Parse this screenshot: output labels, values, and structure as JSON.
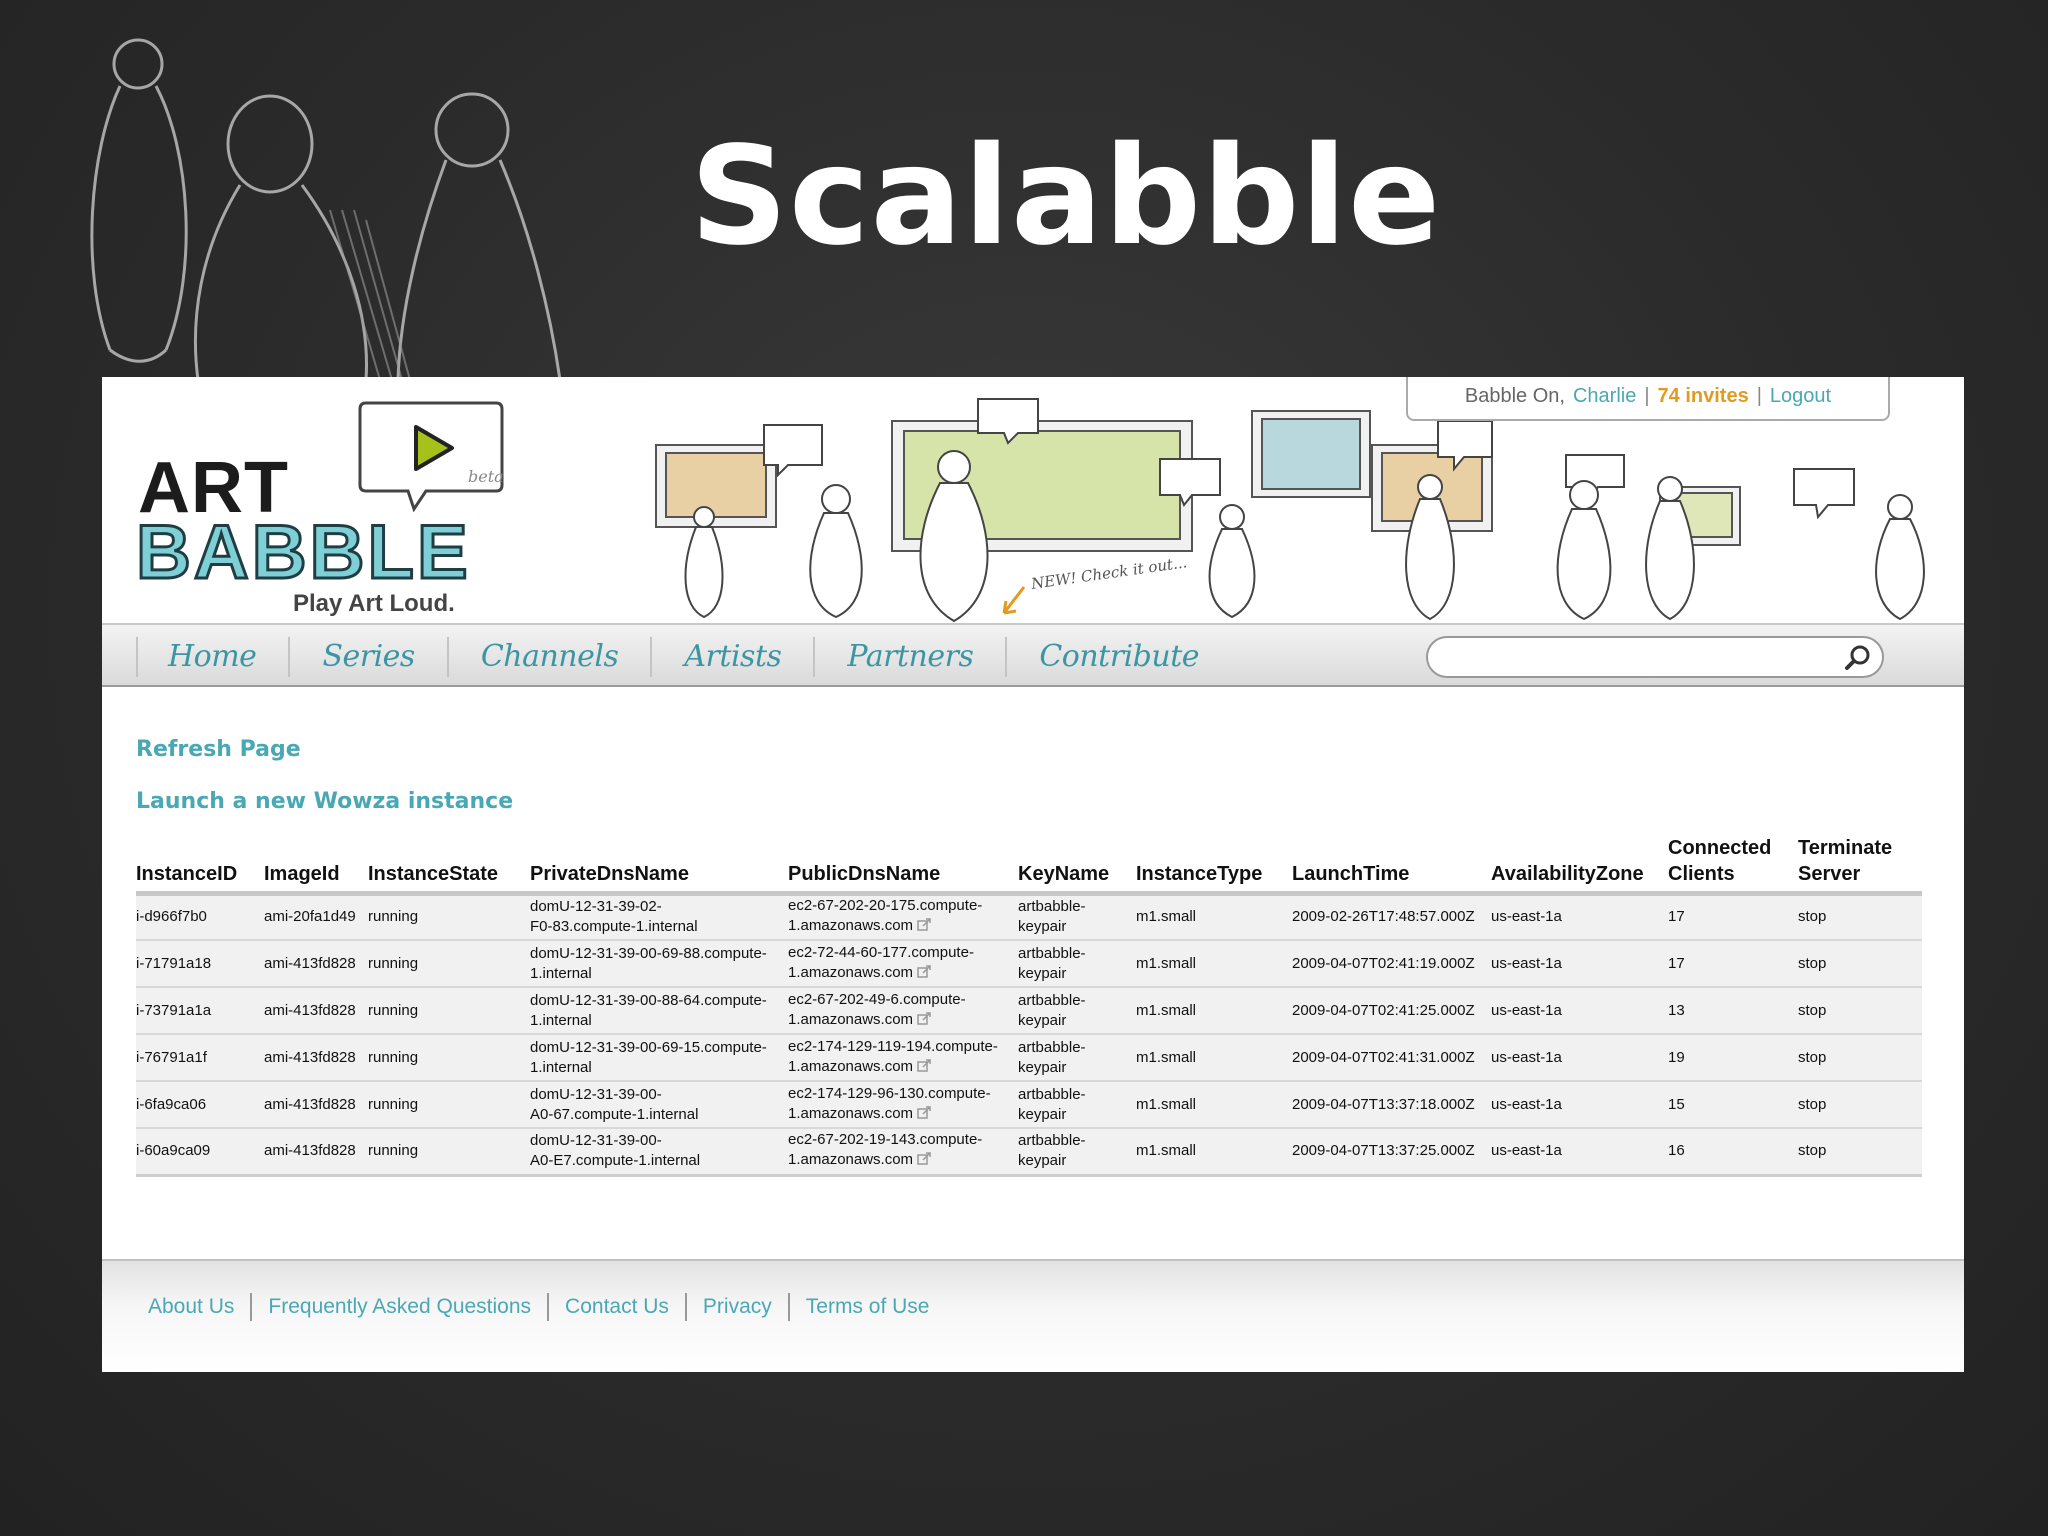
{
  "slide": {
    "title": "Scalabble"
  },
  "header": {
    "logo_art": "ART",
    "logo_babble": "BABBLE",
    "logo_beta": "beta",
    "tagline": "Play Art Loud.",
    "new_note": "NEW! Check it out...",
    "user_box": {
      "prefix": "Babble On,",
      "user": "Charlie",
      "separator": "|",
      "invites": "74 invites",
      "logout": "Logout"
    }
  },
  "nav": {
    "items": [
      "Home",
      "Series",
      "Channels",
      "Artists",
      "Partners",
      "Contribute"
    ],
    "search_placeholder": ""
  },
  "actions": {
    "refresh": "Refresh Page",
    "launch": "Launch a new Wowza instance"
  },
  "table": {
    "headers": {
      "instance_id": "InstanceID",
      "image_id": "ImageId",
      "state": "InstanceState",
      "private_dns": "PrivateDnsName",
      "public_dns": "PublicDnsName",
      "key_name": "KeyName",
      "instance_type": "InstanceType",
      "launch_time": "LaunchTime",
      "zone": "AvailabilityZone",
      "clients_line1": "Connected",
      "clients_line2": "Clients",
      "terminate_line1": "Terminate",
      "terminate_line2": "Server"
    },
    "rows": [
      {
        "instance_id": "i-d966f7b0",
        "image_id": "ami-20fa1d49",
        "state": "running",
        "private_dns": [
          "domU-12-31-39-02-",
          "F0-83.compute-1.internal"
        ],
        "public_dns": [
          "ec2-67-202-20-175.compute-",
          "1.amazonaws.com"
        ],
        "key_name": [
          "artbabble-",
          "keypair"
        ],
        "instance_type": "m1.small",
        "launch_time": "2009-02-26T17:48:57.000Z",
        "zone": "us-east-1a",
        "clients": "17",
        "terminate": "stop"
      },
      {
        "instance_id": "i-71791a18",
        "image_id": "ami-413fd828",
        "state": "running",
        "private_dns": [
          "domU-12-31-39-00-69-88.compute-",
          "1.internal"
        ],
        "public_dns": [
          "ec2-72-44-60-177.compute-",
          "1.amazonaws.com"
        ],
        "key_name": [
          "artbabble-",
          "keypair"
        ],
        "instance_type": "m1.small",
        "launch_time": "2009-04-07T02:41:19.000Z",
        "zone": "us-east-1a",
        "clients": "17",
        "terminate": "stop"
      },
      {
        "instance_id": "i-73791a1a",
        "image_id": "ami-413fd828",
        "state": "running",
        "private_dns": [
          "domU-12-31-39-00-88-64.compute-",
          "1.internal"
        ],
        "public_dns": [
          "ec2-67-202-49-6.compute-",
          "1.amazonaws.com"
        ],
        "key_name": [
          "artbabble-",
          "keypair"
        ],
        "instance_type": "m1.small",
        "launch_time": "2009-04-07T02:41:25.000Z",
        "zone": "us-east-1a",
        "clients": "13",
        "terminate": "stop"
      },
      {
        "instance_id": "i-76791a1f",
        "image_id": "ami-413fd828",
        "state": "running",
        "private_dns": [
          "domU-12-31-39-00-69-15.compute-",
          "1.internal"
        ],
        "public_dns": [
          "ec2-174-129-119-194.compute-",
          "1.amazonaws.com"
        ],
        "key_name": [
          "artbabble-",
          "keypair"
        ],
        "instance_type": "m1.small",
        "launch_time": "2009-04-07T02:41:31.000Z",
        "zone": "us-east-1a",
        "clients": "19",
        "terminate": "stop"
      },
      {
        "instance_id": "i-6fa9ca06",
        "image_id": "ami-413fd828",
        "state": "running",
        "private_dns": [
          "domU-12-31-39-00-",
          "A0-67.compute-1.internal"
        ],
        "public_dns": [
          "ec2-174-129-96-130.compute-",
          "1.amazonaws.com"
        ],
        "key_name": [
          "artbabble-",
          "keypair"
        ],
        "instance_type": "m1.small",
        "launch_time": "2009-04-07T13:37:18.000Z",
        "zone": "us-east-1a",
        "clients": "15",
        "terminate": "stop"
      },
      {
        "instance_id": "i-60a9ca09",
        "image_id": "ami-413fd828",
        "state": "running",
        "private_dns": [
          "domU-12-31-39-00-",
          "A0-E7.compute-1.internal"
        ],
        "public_dns": [
          "ec2-67-202-19-143.compute-",
          "1.amazonaws.com"
        ],
        "key_name": [
          "artbabble-",
          "keypair"
        ],
        "instance_type": "m1.small",
        "launch_time": "2009-04-07T13:37:25.000Z",
        "zone": "us-east-1a",
        "clients": "16",
        "terminate": "stop"
      }
    ]
  },
  "footer": {
    "links": [
      "About Us",
      "Frequently Asked Questions",
      "Contact Us",
      "Privacy",
      "Terms of Use"
    ]
  },
  "colors": {
    "accent": "#4aa8b4",
    "invites": "#e39a1f",
    "running": "#22a022",
    "slide_bg": "#2b2b2b"
  },
  "icons": {
    "search": "magnifier-icon",
    "external": "external-link-icon",
    "play": "play-icon"
  }
}
